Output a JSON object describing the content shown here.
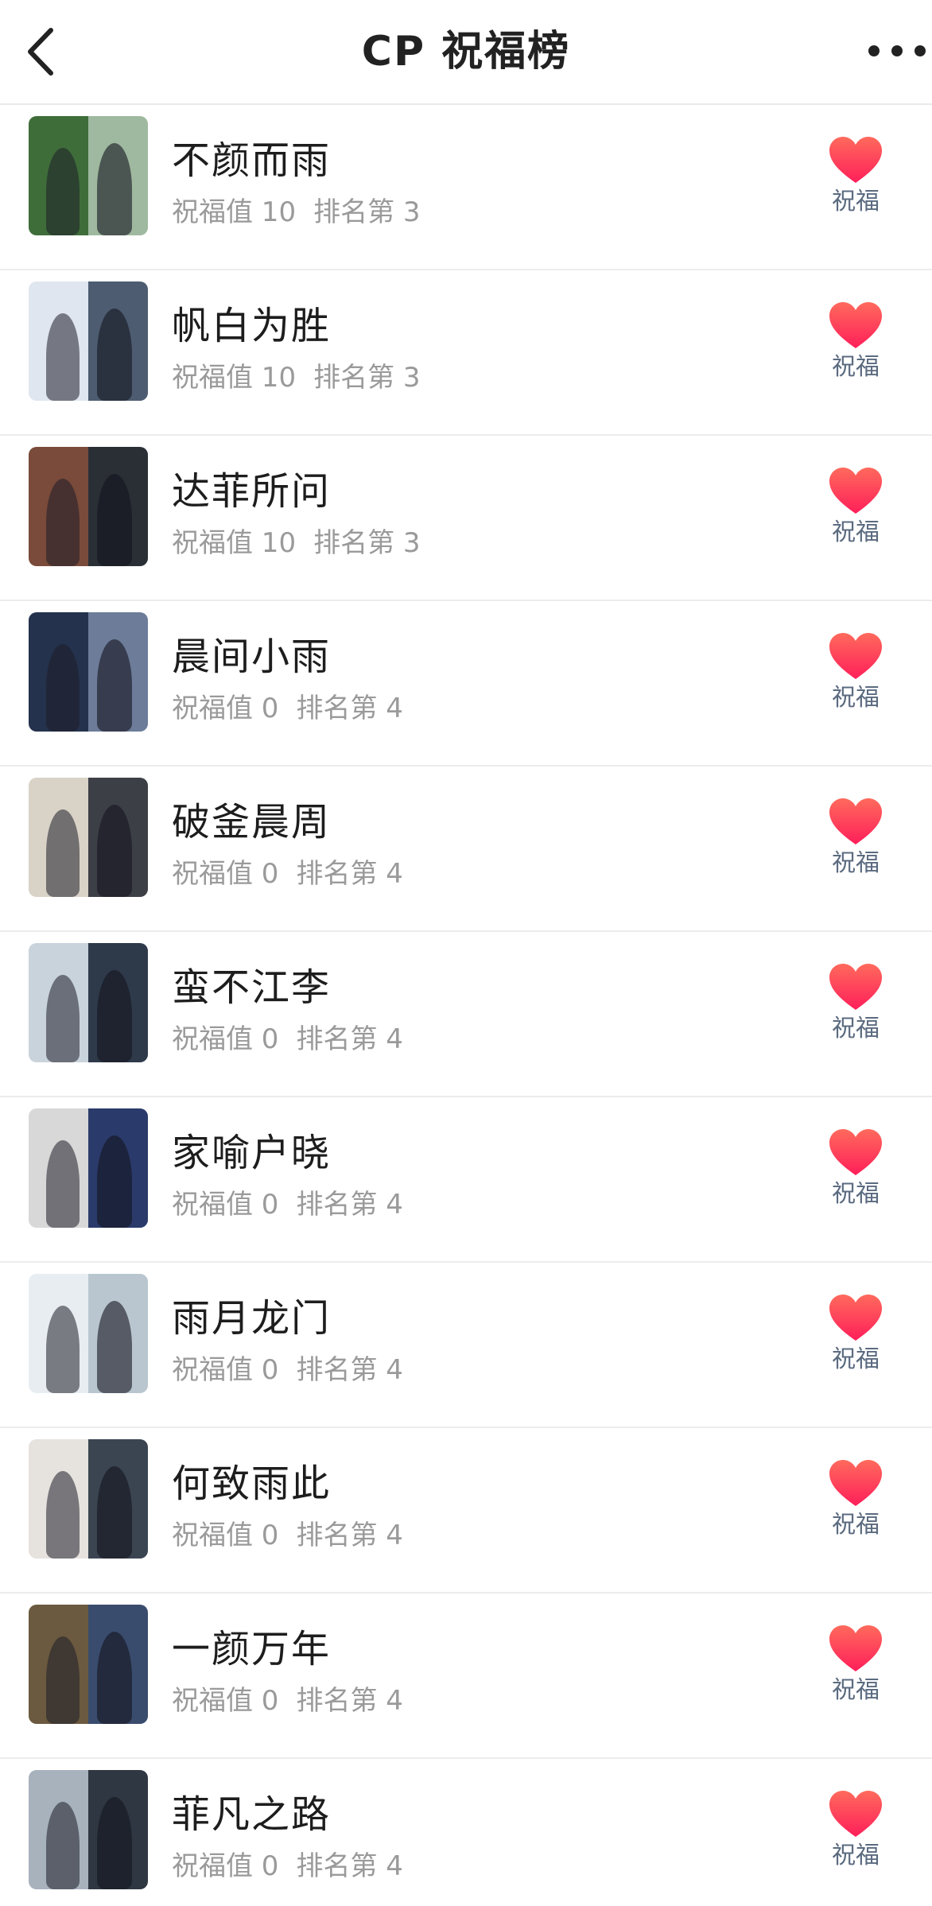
{
  "header": {
    "title": "CP 祝福榜"
  },
  "colors": {
    "heart_top": "#ff6a5c",
    "heart_bottom": "#ff1f5a",
    "title": "#222222",
    "meta": "#9a9a9a",
    "bless_label": "#5b6b80"
  },
  "items": [
    {
      "name": "不颜而雨",
      "value_text": "祝福值 10",
      "rank_text": "排名第 3",
      "bless_label": "祝福"
    },
    {
      "name": "帆白为胜",
      "value_text": "祝福值 10",
      "rank_text": "排名第 3",
      "bless_label": "祝福"
    },
    {
      "name": "达菲所问",
      "value_text": "祝福值 10",
      "rank_text": "排名第 3",
      "bless_label": "祝福"
    },
    {
      "name": "晨间小雨",
      "value_text": "祝福值 0",
      "rank_text": "排名第 4",
      "bless_label": "祝福"
    },
    {
      "name": "破釜晨周",
      "value_text": "祝福值 0",
      "rank_text": "排名第 4",
      "bless_label": "祝福"
    },
    {
      "name": "蛮不江李",
      "value_text": "祝福值 0",
      "rank_text": "排名第 4",
      "bless_label": "祝福"
    },
    {
      "name": "家喻户晓",
      "value_text": "祝福值 0",
      "rank_text": "排名第 4",
      "bless_label": "祝福"
    },
    {
      "name": "雨月龙门",
      "value_text": "祝福值 0",
      "rank_text": "排名第 4",
      "bless_label": "祝福"
    },
    {
      "name": "何致雨此",
      "value_text": "祝福值 0",
      "rank_text": "排名第 4",
      "bless_label": "祝福"
    },
    {
      "name": "一颜万年",
      "value_text": "祝福值 0",
      "rank_text": "排名第 4",
      "bless_label": "祝福"
    },
    {
      "name": "菲凡之路",
      "value_text": "祝福值 0",
      "rank_text": "排名第 4",
      "bless_label": "祝福"
    }
  ]
}
